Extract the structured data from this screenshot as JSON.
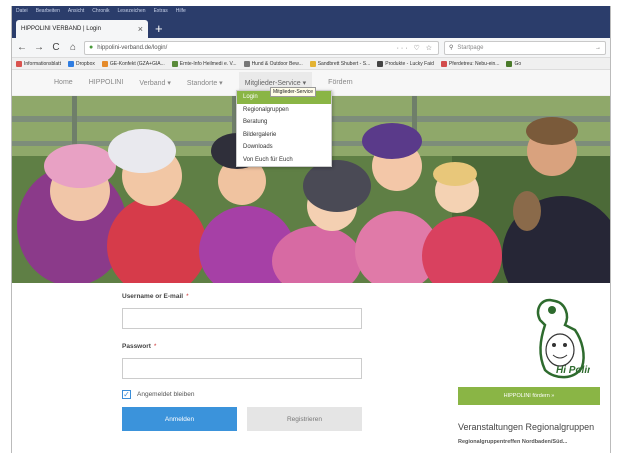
{
  "browser": {
    "menu_items": [
      "Datei",
      "Bearbeiten",
      "Ansicht",
      "Chronik",
      "Lesezeichen",
      "Extras",
      "Hilfe"
    ],
    "tab_title": "HIPPOLINI VERBAND | Login",
    "tab_close": "×",
    "new_tab": "+",
    "back": "←",
    "forward": "→",
    "reload": "C",
    "home": "⌂",
    "url": "hippolini-verband.de/login/",
    "url_icons": "··· ♡ ☆",
    "search_placeholder": "Startpage",
    "search_go": "→"
  },
  "bookmarks": [
    {
      "label": "Informationsblatt",
      "color": "#d9534f"
    },
    {
      "label": "Dropbox",
      "color": "#2f7de1"
    },
    {
      "label": "GE-Konfekt (GZA+GIA...",
      "color": "#e58b2b"
    },
    {
      "label": "Ernte-Info Heilmedi e. V...",
      "color": "#5a8a3a"
    },
    {
      "label": "Hund & Outdoor Bew...",
      "color": "#777777"
    },
    {
      "label": "Sandbrett Shubert - S...",
      "color": "#e4b333"
    },
    {
      "label": "Produkte - Lucky Faid",
      "color": "#444444"
    },
    {
      "label": "Pferdetreu: Nebu-ein...",
      "color": "#d24b4b"
    },
    {
      "label": "Go",
      "color": "#4a7a2a"
    }
  ],
  "site_nav": {
    "items": [
      "Home",
      "HIPPOLINI",
      "Verband ▾",
      "Standorte ▾",
      "Mitglieder-Service ▾",
      "Fördern"
    ],
    "active_index": 4
  },
  "dropdown": {
    "items": [
      "Login",
      "Regionalgruppen",
      "Beratung",
      "Bildergalerie",
      "Downloads",
      "Von Euch für Euch"
    ],
    "highlighted_index": 0,
    "tooltip": "Mitglieder-Service"
  },
  "login_form": {
    "username_label": "Username or E-mail",
    "password_label": "Passwort",
    "required_mark": "*",
    "remember_label": "Angemeldet bleiben",
    "remember_checked": true,
    "login_button": "Anmelden",
    "register_button": "Registrieren"
  },
  "sidebar": {
    "logo_text": "hippolini",
    "logo_subtext": "Hi Polini",
    "cta_button": "HIPPOLINI fördern »",
    "events_title": "Veranstaltungen Regionalgruppen",
    "events_subtitle": "Regionalgruppentreffen Nordbaden/Süd..."
  },
  "colors": {
    "accent_green": "#8ab545",
    "primary_blue": "#3b93db",
    "chrome_dark": "#2b3d6b"
  }
}
